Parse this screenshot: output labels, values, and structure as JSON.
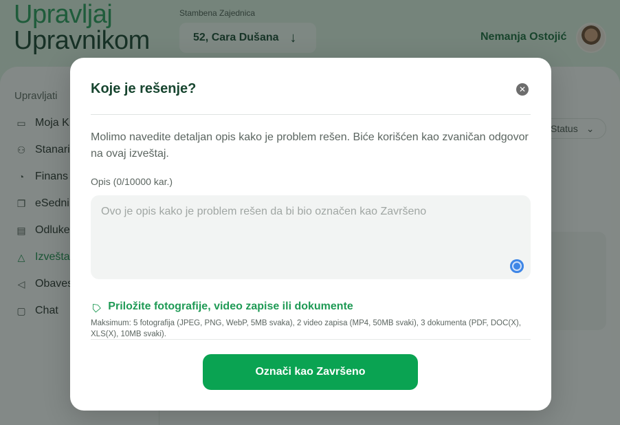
{
  "brand": {
    "line1": "Upravljaj",
    "line2": "Upravnikom"
  },
  "header": {
    "community_label": "Stambena Zajednica",
    "building": "52, Cara Dušana",
    "user_name": "Nemanja Ostojić"
  },
  "sidebar": {
    "heading": "Upravljati",
    "items": [
      {
        "label": "Moja K",
        "icon": "card-icon"
      },
      {
        "label": "Stanari",
        "icon": "users-icon"
      },
      {
        "label": "Finans",
        "icon": "pie-chart-icon"
      },
      {
        "label": "eSedni",
        "icon": "copy-icon"
      },
      {
        "label": "Odluke",
        "icon": "document-icon"
      },
      {
        "label": "Izvešta",
        "icon": "warning-icon",
        "active": true
      },
      {
        "label": "Obaves",
        "icon": "megaphone-icon"
      },
      {
        "label": "Chat",
        "icon": "chat-icon"
      }
    ]
  },
  "filter": {
    "status_label": "Status"
  },
  "modal": {
    "title": "Koje je rešenje?",
    "description": "Molimo navedite detaljan opis kako je problem rešen. Biće korišćen kao zvaničan odgovor na ovaj izveštaj.",
    "field_label": "Opis (0/10000 kar.)",
    "textarea_value": "",
    "textarea_placeholder": "Ovo je opis kako je problem rešen da bi bio označen kao Završeno",
    "attach_label": "Priložite fotografije, video zapise ili dokumente",
    "attach_hint": "Maksimum: 5 fotografija (JPEG, PNG, WebP, 5MB svaka), 2 video zapisa (MP4, 50MB svaki), 3 dokumenta (PDF, DOC(X), XLS(X), 10MB svaki).",
    "submit_label": "Označi kao Završeno"
  },
  "colors": {
    "accent": "#0aa352",
    "title_green": "#17452f",
    "link_green": "#1f9a55"
  }
}
